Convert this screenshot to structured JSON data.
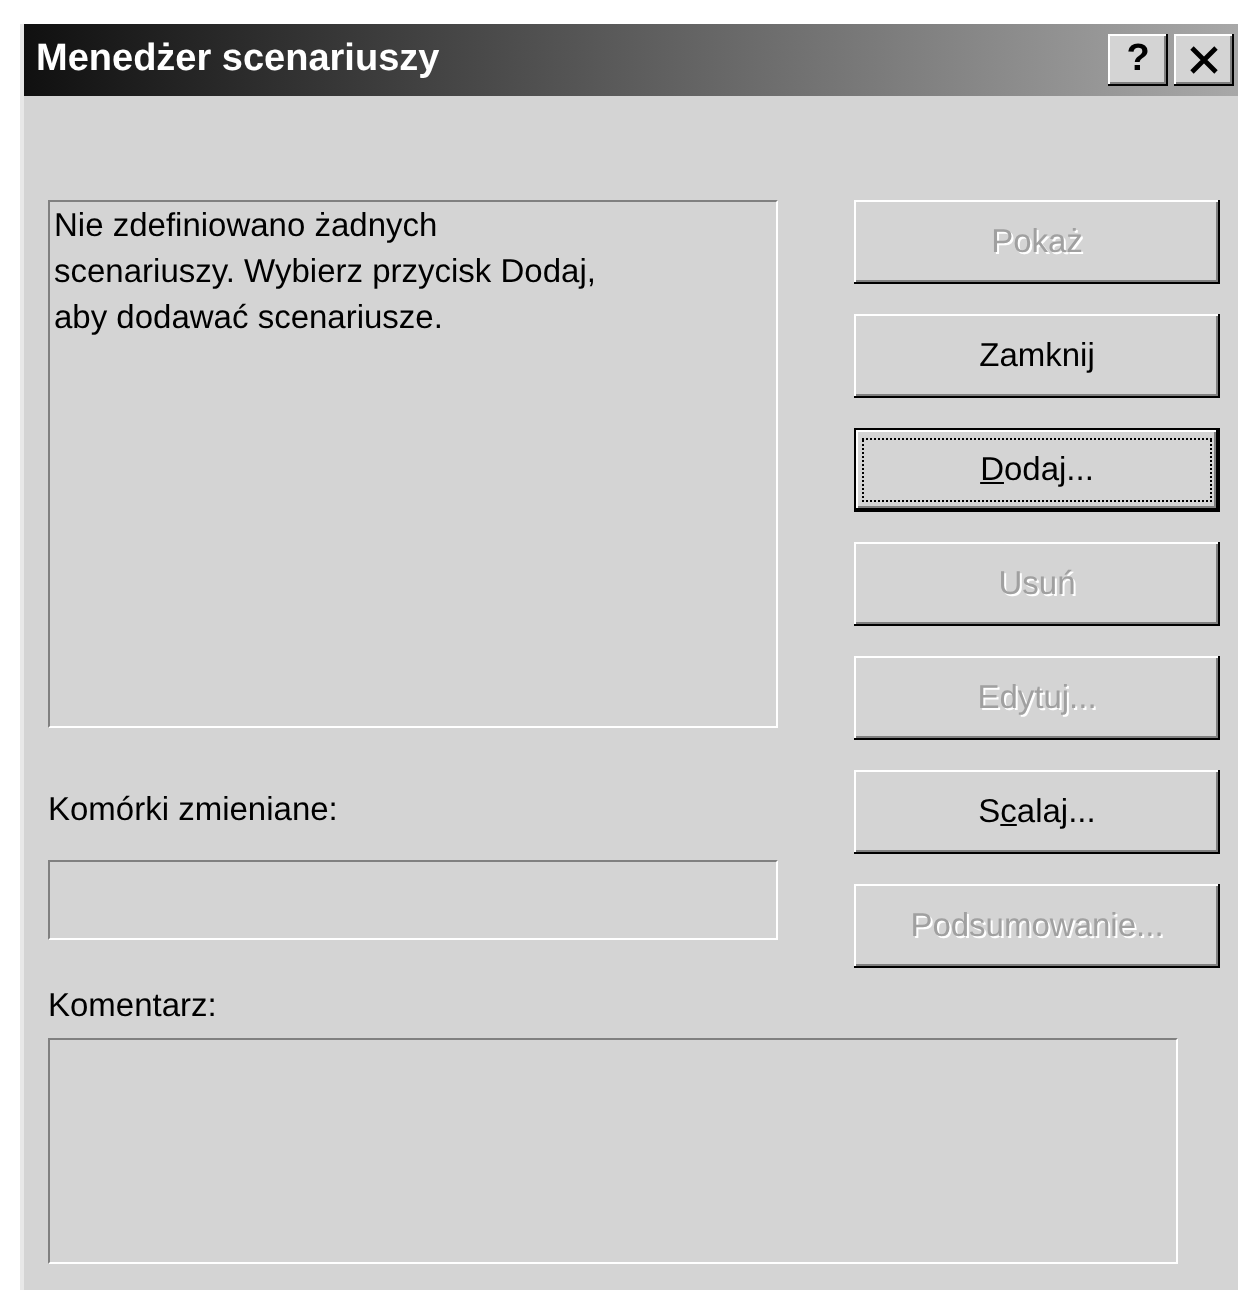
{
  "window": {
    "title": "Menedżer scenariuszy",
    "title_buttons": [
      {
        "kind": "help",
        "label": "?"
      },
      {
        "kind": "close"
      }
    ]
  },
  "scenario_list": {
    "message": "Nie zdefiniowano żadnych\nscenariuszy. Wybierz przycisk Dodaj,\naby dodawać scenariusze."
  },
  "buttons": [
    {
      "label_parts": {
        "before": "Pokaż"
      },
      "disabled": true,
      "default": false,
      "focused": false
    },
    {
      "label_parts": {
        "before": "Zamknij"
      },
      "disabled": false,
      "default": false,
      "focused": false
    },
    {
      "label_parts": {
        "key": "D",
        "after": "odaj..."
      },
      "disabled": false,
      "default": true,
      "focused": true
    },
    {
      "label_parts": {
        "before": "Usuń"
      },
      "disabled": true,
      "default": false,
      "focused": false
    },
    {
      "label_parts": {
        "before": "Edytuj..."
      },
      "disabled": true,
      "default": false,
      "focused": false
    },
    {
      "label_parts": {
        "before": "S",
        "key": "c",
        "after": "alaj..."
      },
      "disabled": false,
      "default": false,
      "focused": false
    },
    {
      "label_parts": {
        "before": "Podsumowanie..."
      },
      "disabled": true,
      "default": false,
      "focused": false
    }
  ],
  "changing_cells": {
    "label": "Komórki zmieniane:",
    "disabled": true
  },
  "comment": {
    "label": "Komentarz:",
    "disabled": true
  }
}
